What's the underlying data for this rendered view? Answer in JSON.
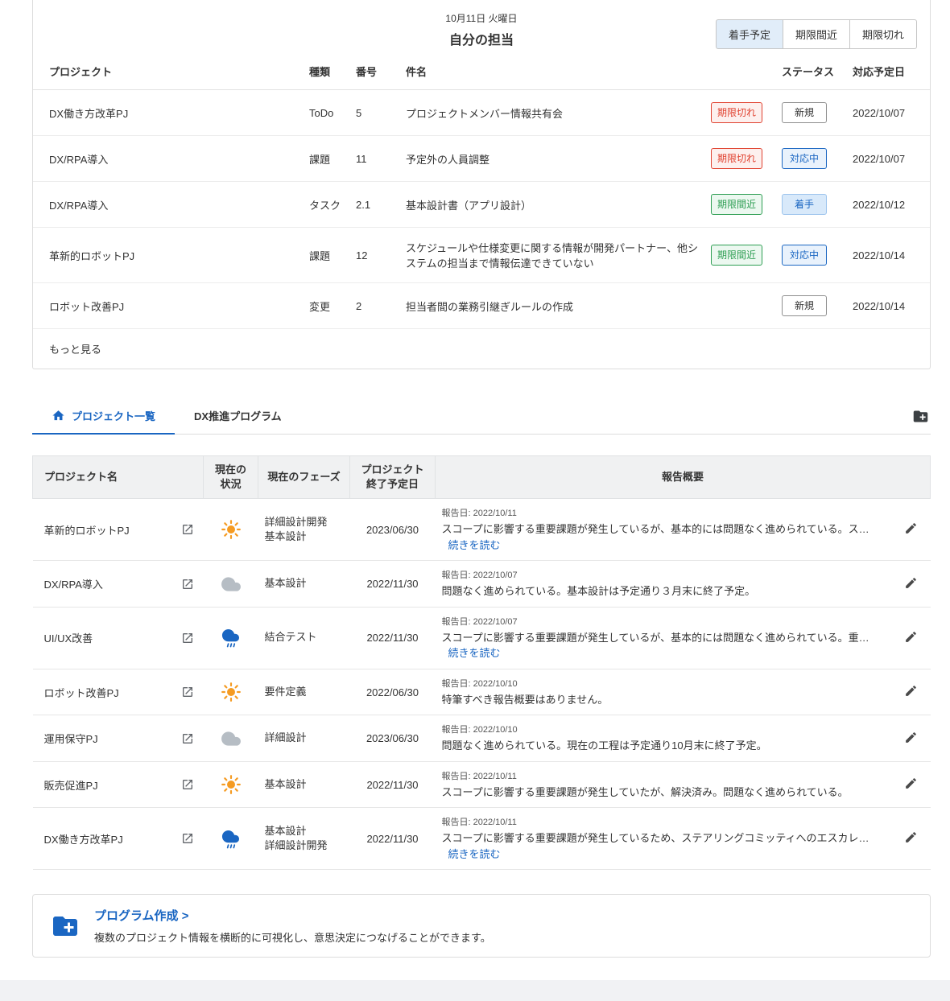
{
  "header": {
    "date": "10月11日 火曜日",
    "title": "自分の担当",
    "filters": [
      {
        "key": "planned",
        "label": "着手予定",
        "active": true
      },
      {
        "key": "near-deadline",
        "label": "期限間近",
        "active": false
      },
      {
        "key": "overdue",
        "label": "期限切れ",
        "active": false
      }
    ]
  },
  "tasks": {
    "columns": {
      "project": "プロジェクト",
      "type": "種類",
      "number": "番号",
      "subject": "件名",
      "status": "ステータス",
      "due": "対応予定日"
    },
    "more_label": "もっと見る",
    "rows": [
      {
        "project": "DX働き方改革PJ",
        "type": "ToDo",
        "number": "5",
        "subject": "プロジェクトメンバー情報共有会",
        "deadline": "期限切れ",
        "deadline_kind": "overdue",
        "status": "新規",
        "status_kind": "new",
        "due": "2022/10/07"
      },
      {
        "project": "DX/RPA導入",
        "type": "課題",
        "number": "11",
        "subject": "予定外の人員調整",
        "deadline": "期限切れ",
        "deadline_kind": "overdue",
        "status": "対応中",
        "status_kind": "active",
        "due": "2022/10/07"
      },
      {
        "project": "DX/RPA導入",
        "type": "タスク",
        "number": "2.1",
        "subject": "基本設計書（アプリ設計）",
        "deadline": "期限間近",
        "deadline_kind": "near",
        "status": "着手",
        "status_kind": "started",
        "due": "2022/10/12"
      },
      {
        "project": "革新的ロボットPJ",
        "type": "課題",
        "number": "12",
        "subject": "スケジュールや仕様変更に関する情報が開発パートナー、他システムの担当まで情報伝達できていない",
        "deadline": "期限間近",
        "deadline_kind": "near",
        "status": "対応中",
        "status_kind": "active",
        "due": "2022/10/14"
      },
      {
        "project": "ロボット改善PJ",
        "type": "変更",
        "number": "2",
        "subject": "担当者間の業務引継ぎルールの作成",
        "deadline": "",
        "deadline_kind": "none",
        "status": "新規",
        "status_kind": "new",
        "due": "2022/10/14"
      }
    ]
  },
  "tabs": {
    "items": [
      {
        "key": "project-list",
        "label": "プロジェクト一覧",
        "active": true,
        "icon": "home-icon"
      },
      {
        "key": "dx-program",
        "label": "DX推進プログラム",
        "active": false,
        "icon": ""
      }
    ],
    "add_icon": "folder-plus-icon"
  },
  "projects": {
    "columns": {
      "name": "プロジェクト名",
      "weather": "現在の\n状況",
      "phase": "現在のフェーズ",
      "end_date": "プロジェクト\n終了予定日",
      "summary": "報告概要"
    },
    "read_more_label": "続きを読む",
    "rows": [
      {
        "name": "革新的ロボットPJ",
        "weather": "sunny",
        "phase": "詳細設計開発\n基本設計",
        "end_date": "2023/06/30",
        "report_date": "報告日: 2022/10/11",
        "summary": "スコープに影響する重要課題が発生しているが、基本的には問題なく進められている。ス…",
        "read_more": true
      },
      {
        "name": "DX/RPA導入",
        "weather": "cloudy",
        "phase": "基本設計",
        "end_date": "2022/11/30",
        "report_date": "報告日: 2022/10/07",
        "summary": "問題なく進められている。基本設計は予定通り３月末に終了予定。",
        "read_more": false
      },
      {
        "name": "UI/UX改善",
        "weather": "rainy",
        "phase": "結合テスト",
        "end_date": "2022/11/30",
        "report_date": "報告日: 2022/10/07",
        "summary": "スコープに影響する重要課題が発生しているが、基本的には問題なく進められている。重…",
        "read_more": true
      },
      {
        "name": "ロボット改善PJ",
        "weather": "sunny",
        "phase": "要件定義",
        "end_date": "2022/06/30",
        "report_date": "報告日: 2022/10/10",
        "summary": "特筆すべき報告概要はありません。",
        "read_more": false
      },
      {
        "name": "運用保守PJ",
        "weather": "cloudy",
        "phase": "詳細設計",
        "end_date": "2023/06/30",
        "report_date": "報告日: 2022/10/10",
        "summary": "問題なく進められている。現在の工程は予定通り10月末に終了予定。",
        "read_more": false
      },
      {
        "name": "販売促進PJ",
        "weather": "sunny",
        "phase": "基本設計",
        "end_date": "2022/11/30",
        "report_date": "報告日: 2022/10/11",
        "summary": "スコープに影響する重要課題が発生していたが、解決済み。問題なく進められている。",
        "read_more": false
      },
      {
        "name": "DX働き方改革PJ",
        "weather": "rainy",
        "phase": "基本設計\n詳細設計開発",
        "end_date": "2022/11/30",
        "report_date": "報告日: 2022/10/11",
        "summary": "スコープに影響する重要課題が発生しているため、ステアリングコミッティへのエスカレ…",
        "read_more": true
      }
    ]
  },
  "program_create": {
    "title": "プログラム作成 >",
    "description": "複数のプロジェクト情報を横断的に可視化し、意思決定につなげることができます。"
  },
  "colors": {
    "accent_blue": "#1a66c2",
    "overdue_red": "#e0412f",
    "near_green": "#2e9e53",
    "sun_orange": "#f59b22",
    "cloud_gray": "#b6bdc4"
  }
}
